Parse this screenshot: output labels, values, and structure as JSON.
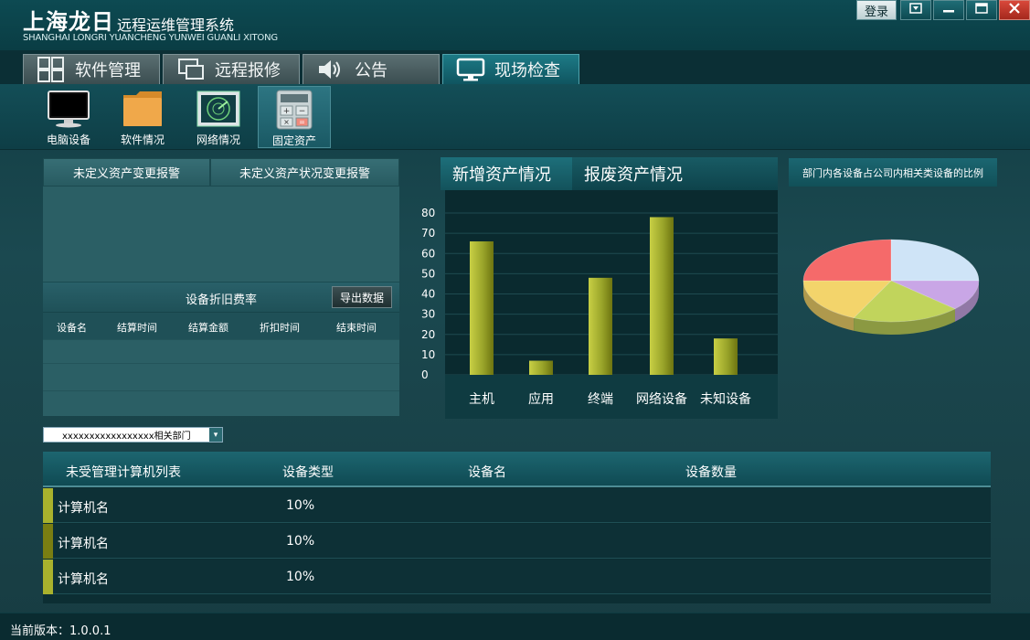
{
  "app": {
    "title": "上海龙日",
    "title_small": "远程运维管理系统",
    "subtitle": "SHANGHAI LONGRI YUANCHENG YUNWEI GUANLI XITONG",
    "login_label": "登录"
  },
  "tabs": [
    {
      "label": "软件管理",
      "icon": "grid-icon"
    },
    {
      "label": "远程报修",
      "icon": "monitor-pair-icon"
    },
    {
      "label": "公告",
      "icon": "speaker-icon"
    },
    {
      "label": "现场检查",
      "icon": "monitor-icon",
      "active": true
    }
  ],
  "toolbar": [
    {
      "label": "电脑设备",
      "icon": "computer-icon"
    },
    {
      "label": "软件情况",
      "icon": "folder-icon"
    },
    {
      "label": "网络情况",
      "icon": "radar-icon"
    },
    {
      "label": "固定资产",
      "icon": "calculator-icon",
      "active": true
    }
  ],
  "alarm_tabs": [
    "未定义资产变更报警",
    "未定义资产状况变更报警"
  ],
  "depreciation": {
    "title": "设备折旧费率",
    "export_label": "导出数据",
    "columns": [
      "设备名",
      "结算时间",
      "结算金额",
      "折扣时间",
      "结束时间"
    ]
  },
  "chart_tabs": [
    "新增资产情况",
    "报废资产情况"
  ],
  "chart_data": {
    "type": "bar",
    "categories": [
      "主机",
      "应用",
      "终端",
      "网络设备",
      "未知设备"
    ],
    "values": [
      66,
      7,
      48,
      78,
      18
    ],
    "yticks": [
      0,
      10,
      20,
      30,
      40,
      50,
      60,
      70,
      80
    ],
    "ylim": [
      0,
      85
    ],
    "xlabel": "",
    "ylabel": "",
    "grid": true,
    "bar_color": "#9aa52a"
  },
  "pie": {
    "title": "部门内各设备占公司内相关类设备的比例",
    "slices": [
      {
        "value": 25,
        "color": "#cfe4f7"
      },
      {
        "value": 12,
        "color": "#c9a6e6"
      },
      {
        "value": 20,
        "color": "#c1d45c"
      },
      {
        "value": 18,
        "color": "#f3d46b"
      },
      {
        "value": 25,
        "color": "#f56a6a"
      }
    ]
  },
  "dept_select": {
    "value": "xxxxxxxxxxxxxxxxx相关部门"
  },
  "unmanaged": {
    "columns": [
      "未受管理计算机列表",
      "设备类型",
      "设备名",
      "设备数量"
    ],
    "rows": [
      {
        "name": "计算机名",
        "type": "10%",
        "mark": "#a9b22d"
      },
      {
        "name": "计算机名",
        "type": "10%",
        "mark": "#7a7e12"
      },
      {
        "name": "计算机名",
        "type": "10%",
        "mark": "#a9b22d"
      }
    ]
  },
  "status": {
    "version": "当前版本：1.0.0.1"
  }
}
